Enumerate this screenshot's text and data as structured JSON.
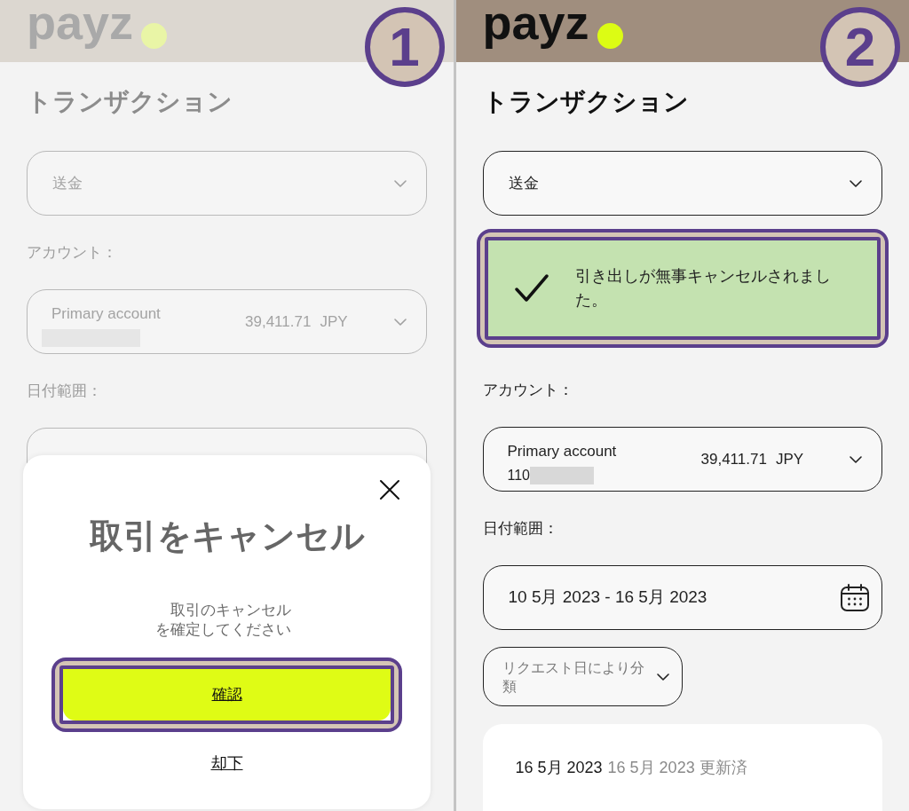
{
  "panels": [
    {
      "step": "1",
      "dimmed": true,
      "logo": "payz",
      "title": "トランザクション",
      "type_select": {
        "value": "送金"
      },
      "account_label": "アカウント：",
      "account_select": {
        "name": "Primary account",
        "balance": "39,411.71",
        "currency": "JPY"
      },
      "date_label": "日付範囲：",
      "date_field": {
        "covered": true
      },
      "dialog": {
        "title": "取引をキャンセル",
        "message": "取引のキャンセルを確定してください",
        "buttons": [
          {
            "kind": "primary",
            "label": "確認",
            "highlighted": true
          },
          {
            "kind": "link",
            "label": "却下",
            "highlighted": false
          }
        ]
      }
    },
    {
      "step": "2",
      "dimmed": false,
      "logo": "payz",
      "title": "トランザクション",
      "type_select": {
        "value": "送金"
      },
      "notice": {
        "kind": "success",
        "message": "引き出しが無事キャンセルされました。",
        "highlighted": true
      },
      "account_label": "アカウント：",
      "account_select": {
        "name": "Primary account",
        "number": "110",
        "balance": "39,411.71",
        "currency": "JPY"
      },
      "date_label": "日付範囲：",
      "date_field": {
        "covered": false,
        "value": "10 5月 2023 - 16 5月 2023"
      },
      "sort_select": {
        "placeholder": "リクエスト日により分類"
      },
      "transactions": [
        {
          "date": "16 5月 2023",
          "updated": "16 5月 2023 更新済"
        }
      ]
    }
  ]
}
